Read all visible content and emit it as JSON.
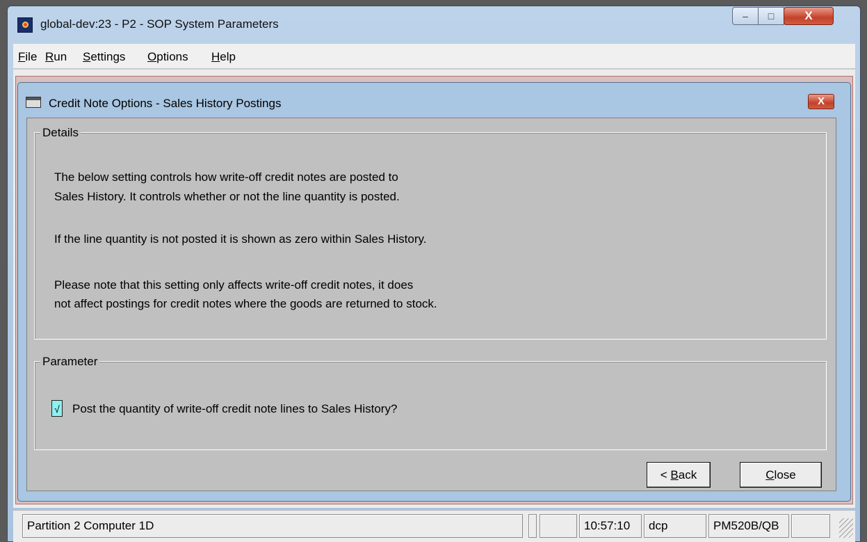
{
  "window": {
    "title": "global-dev:23 - P2 - SOP System Parameters",
    "controls": {
      "minimize": "–",
      "maximize": "□",
      "close": "X"
    }
  },
  "menu": [
    {
      "label": "File",
      "key": "F",
      "rest": "ile"
    },
    {
      "label": "Run",
      "key": "R",
      "rest": "un"
    },
    {
      "label": "Settings",
      "key": "S",
      "rest": "ettings"
    },
    {
      "label": "Options",
      "key": "O",
      "rest": "ptions"
    },
    {
      "label": "Help",
      "key": "H",
      "rest": "elp"
    }
  ],
  "dialog": {
    "title": "Credit Note Options - Sales History Postings",
    "close": "X",
    "details": {
      "label": "Details",
      "paragraphs": [
        "The below setting controls how write-off credit notes are posted to",
        "Sales History.  It controls whether or not the line quantity is posted.",
        "If the line quantity is not posted it is shown as zero within Sales History.",
        "Please note that this setting only affects write-off credit notes, it does",
        "not affect postings for credit notes where the goods are returned to stock."
      ]
    },
    "parameter": {
      "label": "Parameter",
      "checkbox_mark": "√",
      "checked": true,
      "checkbox_label": "Post the quantity of write-off credit note lines to Sales History?"
    },
    "buttons": {
      "back_prefix": "< ",
      "back_key": "B",
      "back_rest": "ack",
      "close_key": "C",
      "close_rest": "lose"
    }
  },
  "statusbar": {
    "location": "Partition 2 Computer 1D",
    "time": "10:57:10",
    "user": "dcp",
    "program": "PM520B/QB"
  },
  "colors": {
    "title_bar": "#bcd3ea",
    "dialog_frame": "#a9c6e2",
    "panel": "#c0c0c0",
    "checkbox": "#8ff0f0",
    "close_button": "#c4412b"
  }
}
